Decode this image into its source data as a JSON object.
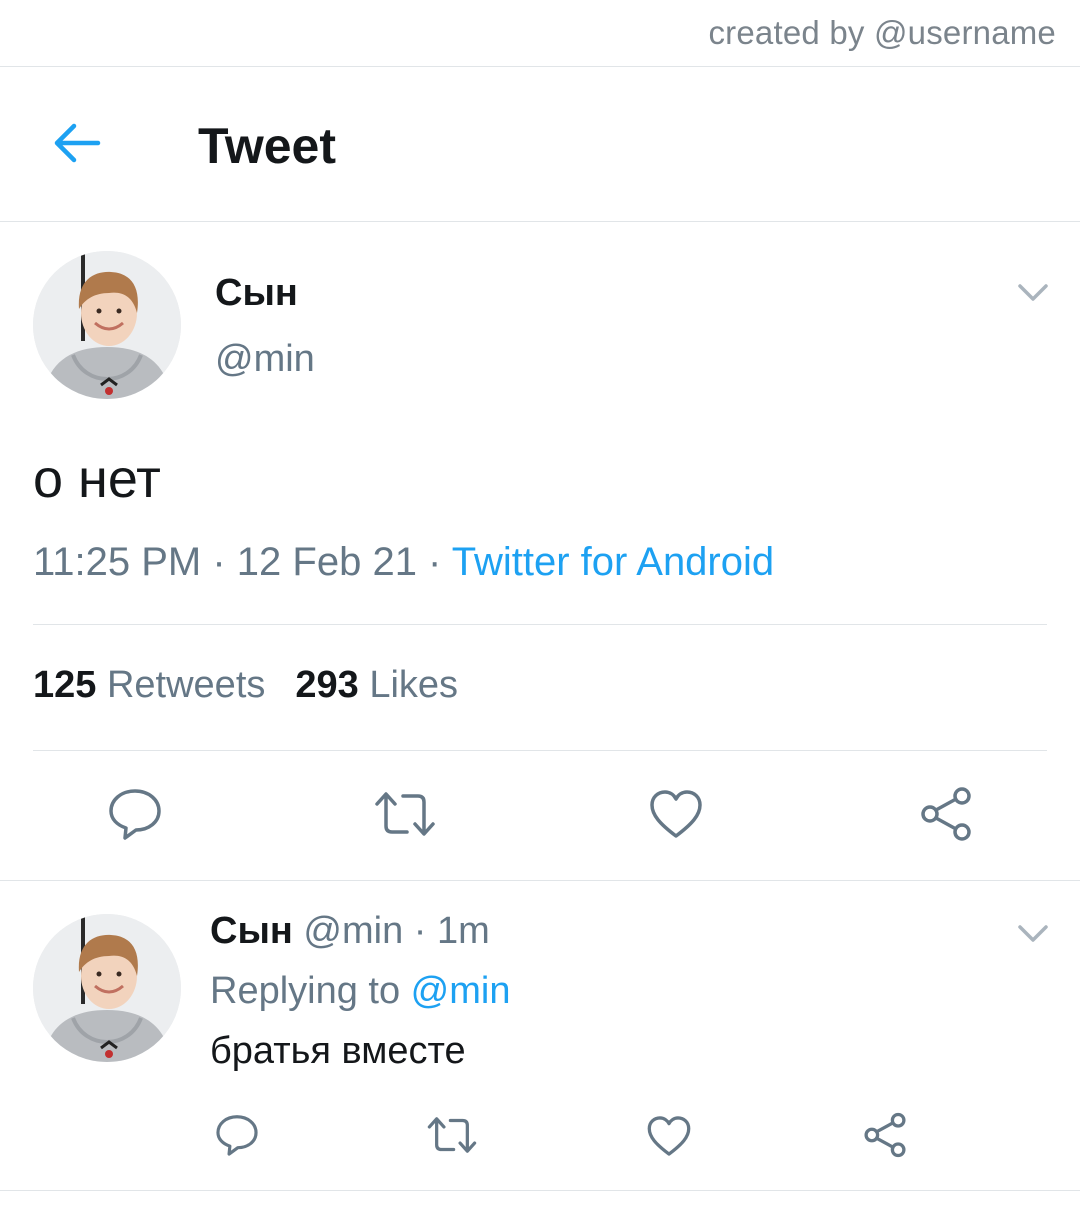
{
  "credit": "created by @username",
  "header": {
    "title": "Tweet"
  },
  "tweet": {
    "name": "Сын",
    "handle": "@min",
    "text": "о нет",
    "time": "11:25 PM",
    "date": "12 Feb 21",
    "separator": " · ",
    "source": "Twitter for Android",
    "retweets_count": "125",
    "retweets_label": "Retweets",
    "likes_count": "293",
    "likes_label": "Likes"
  },
  "reply": {
    "name": "Сын",
    "handle": "@min",
    "separator": " · ",
    "age": "1m",
    "replying_prefix": "Replying to ",
    "replying_to": "@min",
    "text": "братья вместе"
  },
  "colors": {
    "accent": "#1da1f2",
    "icon": "#657786",
    "text": "#14171a",
    "muted": "#657786",
    "divider": "#e1e5e8"
  },
  "icons": {
    "back": "arrow-left-icon",
    "caret": "chevron-down-icon",
    "reply": "comment-icon",
    "retweet": "retweet-icon",
    "like": "heart-icon",
    "share": "share-icon"
  }
}
